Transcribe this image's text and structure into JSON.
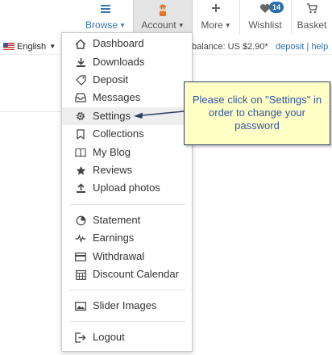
{
  "nav": {
    "browse": "Browse",
    "account": "Account",
    "more": "More",
    "wishlist": "Wishlist",
    "wishlist_count": "14",
    "basket": "Basket"
  },
  "language": {
    "label": "English"
  },
  "balance": {
    "text": "balance: US $2.90*",
    "deposit_link": "deposit",
    "separator": "|",
    "help_link": "help"
  },
  "menu": {
    "group1": [
      {
        "label": "Dashboard",
        "icon": "home-icon"
      },
      {
        "label": "Downloads",
        "icon": "download-icon"
      },
      {
        "label": "Deposit",
        "icon": "tag-icon"
      },
      {
        "label": "Messages",
        "icon": "inbox-icon"
      },
      {
        "label": "Settings",
        "icon": "gear-icon"
      },
      {
        "label": "Collections",
        "icon": "bookmark-icon"
      },
      {
        "label": "My Blog",
        "icon": "book-icon"
      },
      {
        "label": "Reviews",
        "icon": "star-icon"
      },
      {
        "label": "Upload photos",
        "icon": "upload-icon"
      }
    ],
    "group2": [
      {
        "label": "Statement",
        "icon": "pie-chart-icon"
      },
      {
        "label": "Earnings",
        "icon": "pulse-icon"
      },
      {
        "label": "Withdrawal",
        "icon": "credit-card-icon"
      },
      {
        "label": "Discount Calendar",
        "icon": "calendar-icon"
      }
    ],
    "group3": [
      {
        "label": "Slider Images",
        "icon": "image-icon"
      }
    ],
    "group4": [
      {
        "label": "Logout",
        "icon": "logout-icon"
      }
    ]
  },
  "callout": {
    "text": "Please click on \"Settings\" in order to change your password"
  },
  "colors": {
    "accent": "#3a78b6",
    "callout_bg": "#ffffc6",
    "callout_text": "#2f55a8",
    "badge": "#2d6ea8"
  }
}
